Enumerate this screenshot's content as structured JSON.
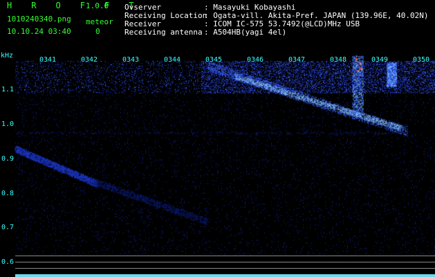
{
  "app": {
    "name": "H R O F F T",
    "version": "1.0.0",
    "filename": "1010240340.png",
    "datetime": "10.10.24 03:40",
    "meteor_label": "meteor",
    "meteor_count": "0"
  },
  "info": {
    "rows": [
      {
        "label": "Ovserver",
        "value": ": Masayuki Kobayashi"
      },
      {
        "label": "Receiving Location",
        "value": ": Ogata-vill. Akita-Pref. JAPAN (139.96E, 40.02N)"
      },
      {
        "label": "Receiver",
        "value": ": ICOM IC-575 53.7492(@LCD)MHz USB"
      },
      {
        "label": "Receiving antenna",
        "value": ": A504HB(yagi 4el)"
      }
    ]
  },
  "spectrogram": {
    "freq_unit": "kHz",
    "time_labels": [
      "0341",
      "0342",
      "0343",
      "0344",
      "0345",
      "0346",
      "0347",
      "0348",
      "0349",
      "0350"
    ],
    "freq_labels": [
      "1.1",
      "1.0",
      "0.9",
      "0.8",
      "0.7",
      "0.6"
    ],
    "freq_values": [
      1.1,
      1.0,
      0.9,
      0.8,
      0.7,
      0.6
    ],
    "freq_range_khz": [
      0.58,
      1.2
    ],
    "colors": {
      "background": "#000000",
      "noise": "#08104a",
      "signal": "#1c3cff",
      "strong": "#8ad8ff",
      "peak": "#ff3030",
      "axis_text": "#39ffff",
      "info_text": "#ffffff",
      "app_text": "#33ff33"
    }
  }
}
